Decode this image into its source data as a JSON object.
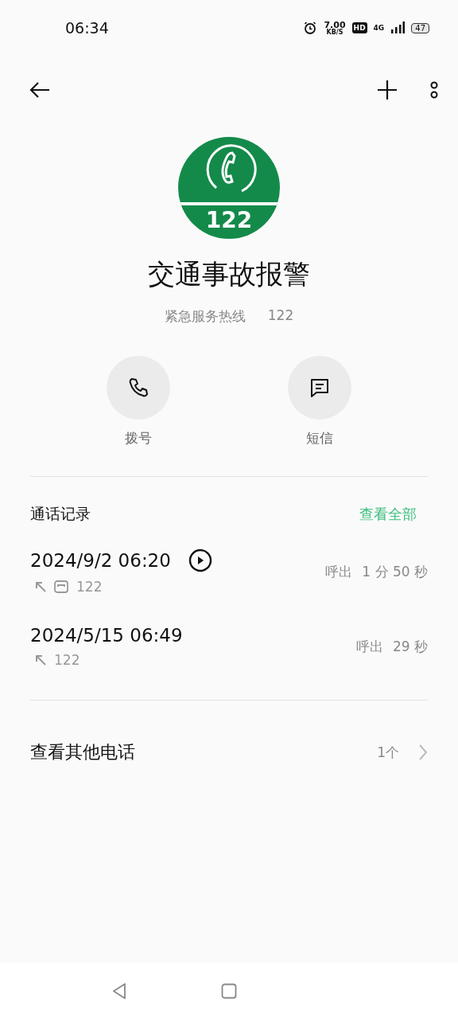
{
  "status_bar": {
    "time": "06:34",
    "speed": "7.00",
    "speed_unit": "KB/S",
    "hd": "HD",
    "network": "4G",
    "battery": "47",
    "alarm": true
  },
  "contact": {
    "logo_text": "122",
    "name": "交通事故报警",
    "label": "紧急服务热线",
    "number": "122"
  },
  "actions": [
    {
      "kind": "call",
      "label": "拨号"
    },
    {
      "kind": "message",
      "label": "短信"
    }
  ],
  "call_log": {
    "title": "通话记录",
    "view_all": "查看全部",
    "calls": [
      {
        "datetime": "2024/9/2 06:20",
        "recorded": true,
        "card_icon": true,
        "number": "122",
        "type": "呼出",
        "duration": "1 分 50 秒"
      },
      {
        "datetime": "2024/5/15 06:49",
        "recorded": false,
        "card_icon": false,
        "number": "122",
        "type": "呼出",
        "duration": "29 秒"
      }
    ]
  },
  "other_numbers": {
    "label": "查看其他电话",
    "count": "1个"
  }
}
